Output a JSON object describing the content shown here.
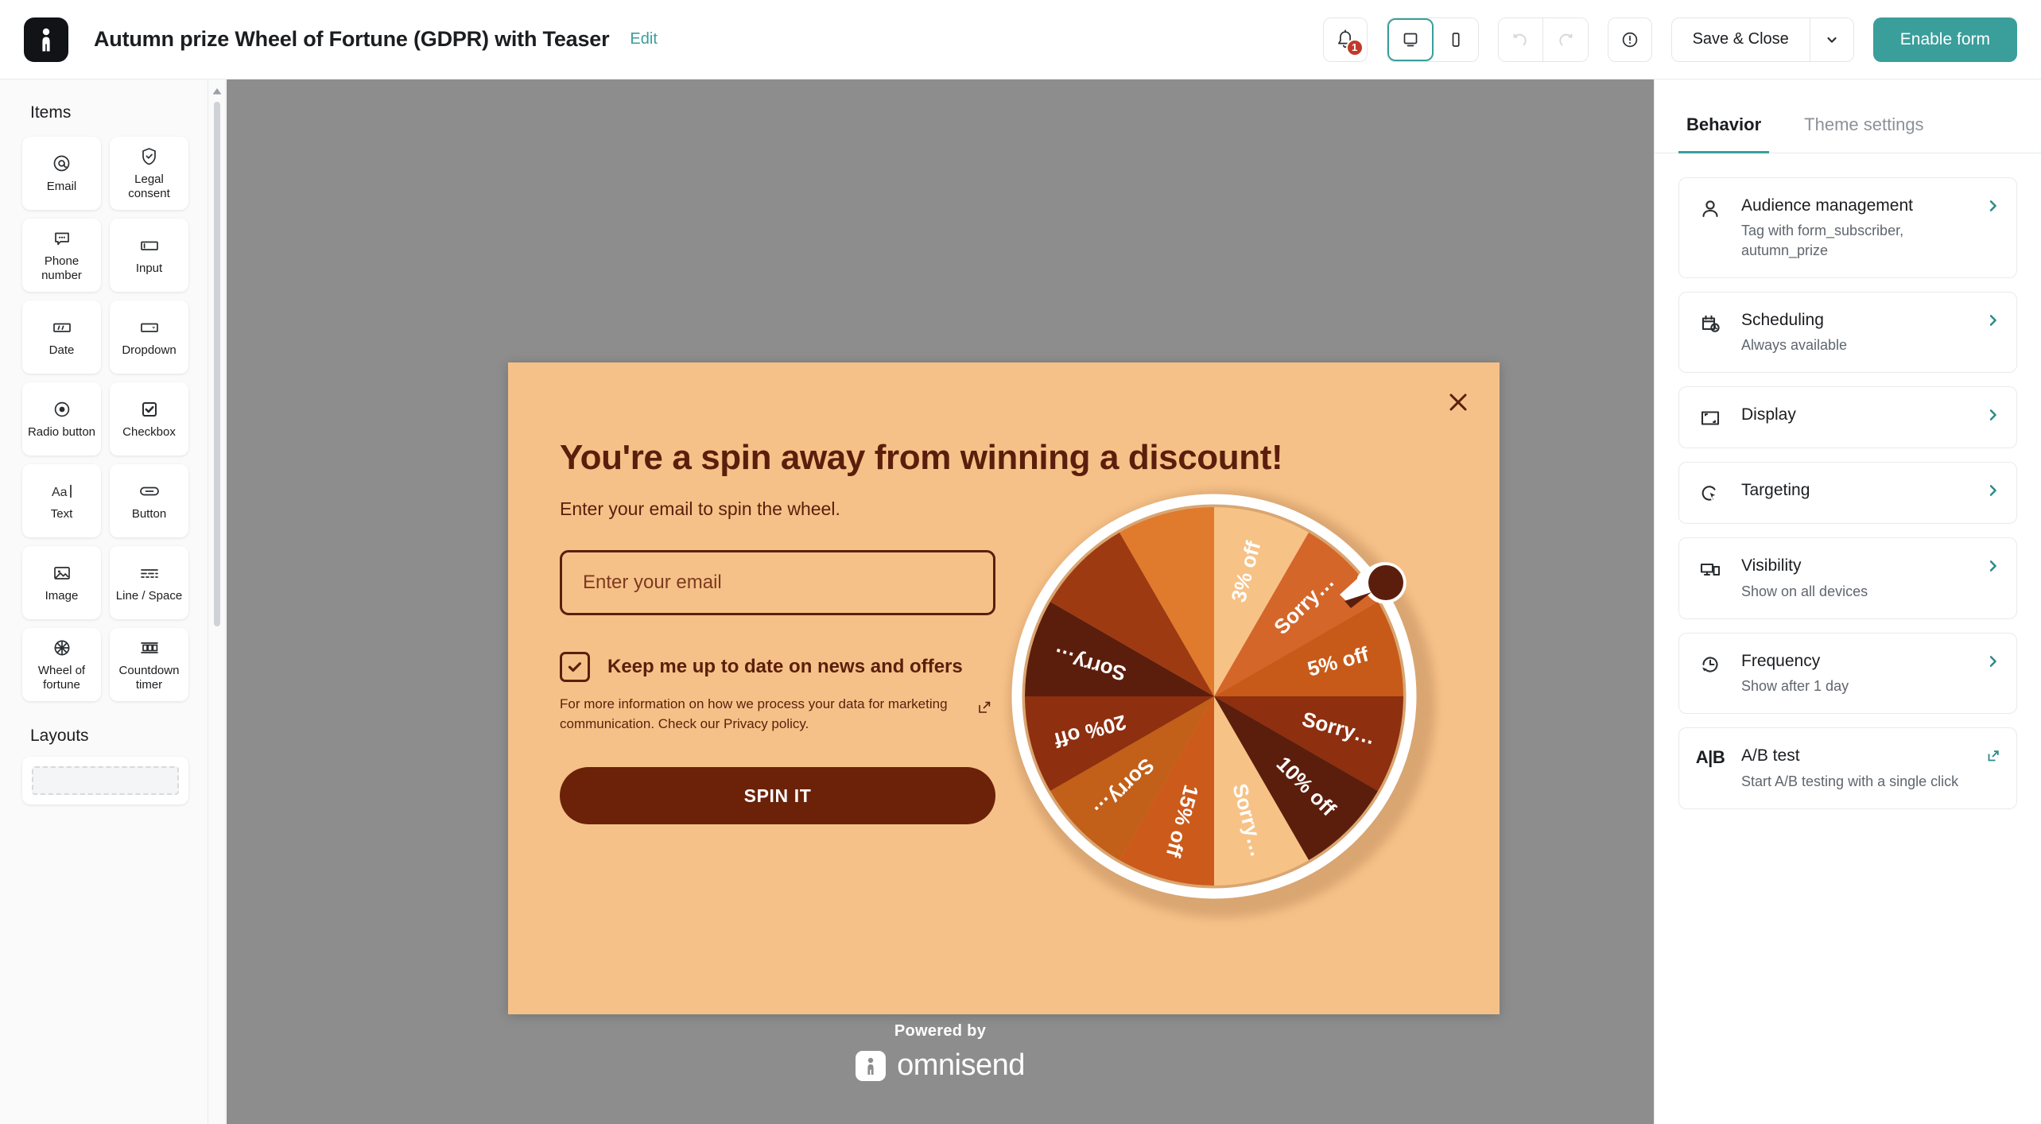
{
  "topbar": {
    "logo_icon": "omnisend-logo-icon",
    "title": "Autumn prize Wheel of Fortune (GDPR) with Teaser",
    "edit_label": "Edit",
    "notifications": {
      "icon": "bell-icon",
      "count": "1"
    },
    "device_desktop_icon": "desktop-icon",
    "device_mobile_icon": "mobile-icon",
    "undo_icon": "undo-icon",
    "redo_icon": "redo-icon",
    "alert_icon": "exclamation-circle-icon",
    "save_label": "Save & Close",
    "save_caret_icon": "chevron-down-icon",
    "enable_label": "Enable form",
    "accent_color": "#3a9e9b"
  },
  "sidebar": {
    "items_heading": "Items",
    "items": [
      {
        "label": "Email",
        "icon": "at-sign-icon"
      },
      {
        "label": "Legal consent",
        "icon": "shield-check-icon"
      },
      {
        "label": "Phone number",
        "icon": "speech-bubble-icon"
      },
      {
        "label": "Input",
        "icon": "text-input-icon"
      },
      {
        "label": "Date",
        "icon": "date-field-icon"
      },
      {
        "label": "Dropdown",
        "icon": "dropdown-icon"
      },
      {
        "label": "Radio button",
        "icon": "radio-button-icon"
      },
      {
        "label": "Checkbox",
        "icon": "checkbox-icon"
      },
      {
        "label": "Text",
        "icon": "text-aa-icon"
      },
      {
        "label": "Button",
        "icon": "button-pill-icon"
      },
      {
        "label": "Image",
        "icon": "image-icon"
      },
      {
        "label": "Line / Space",
        "icon": "line-space-icon"
      },
      {
        "label": "Wheel of fortune",
        "icon": "wheel-of-fortune-icon"
      },
      {
        "label": "Countdown timer",
        "icon": "countdown-timer-icon"
      }
    ],
    "layouts_heading": "Layouts",
    "scroll_up_icon": "caret-up-icon"
  },
  "popup": {
    "close_icon": "close-icon",
    "background_color": "#f6c188",
    "text_color": "#5c1e0c",
    "heading": "You're a spin away from winning a discount!",
    "subheading": "Enter your email to spin the wheel.",
    "email_placeholder": "Enter your email",
    "email_value": "",
    "consent_label": "Keep me up to date on news and offers",
    "consent_checked": true,
    "consent_note": "For more information on how we process your data for marketing communication. Check our Privacy policy.",
    "consent_external_icon": "external-link-icon",
    "spin_button_label": "SPIN IT",
    "spin_button_color": "#6b2209"
  },
  "wheel": {
    "segments": [
      {
        "label": "3% off",
        "color": "#f7c286"
      },
      {
        "label": "Sorry…",
        "color": "#d4662a"
      },
      {
        "label": "5% off",
        "color": "#c75a18"
      },
      {
        "label": "Sorry…",
        "color": "#8e2f10"
      },
      {
        "label": "10% off",
        "color": "#5c1e0c"
      },
      {
        "label": "Sorry…",
        "color": "#f7c286"
      },
      {
        "label": "15% off",
        "color": "#cc5a1a"
      },
      {
        "label": "Sorry…",
        "color": "#c25f18"
      },
      {
        "label": "20% off",
        "color": "#8e2f10"
      },
      {
        "label": "Sorry…",
        "color": "#5c1e0c"
      },
      {
        "label": "",
        "color": "#9e3a12"
      },
      {
        "label": "",
        "color": "#e07a2d"
      }
    ],
    "rim_color": "#ffffff",
    "pointer_color": "#5c1e0c",
    "pointer_icon": "wheel-pointer-icon"
  },
  "footer": {
    "powered_by": "Powered by",
    "brand": "omnisend",
    "brand_icon": "omnisend-mark-icon"
  },
  "rightpanel": {
    "tabs": [
      {
        "label": "Behavior",
        "active": true
      },
      {
        "label": "Theme settings",
        "active": false
      }
    ],
    "cards": [
      {
        "title": "Audience management",
        "desc": "Tag with form_subscriber, autumn_prize",
        "icon": "person-icon",
        "arrow": "chevron-right-icon"
      },
      {
        "title": "Scheduling",
        "desc": "Always available",
        "icon": "calendar-clock-icon",
        "arrow": "chevron-right-icon"
      },
      {
        "title": "Display",
        "desc": "",
        "icon": "display-frame-icon",
        "arrow": "chevron-right-icon"
      },
      {
        "title": "Targeting",
        "desc": "",
        "icon": "targeting-cursor-icon",
        "arrow": "chevron-right-icon"
      },
      {
        "title": "Visibility",
        "desc": "Show on all devices",
        "icon": "devices-icon",
        "arrow": "chevron-right-icon"
      },
      {
        "title": "Frequency",
        "desc": "Show after 1 day",
        "icon": "clock-history-icon",
        "arrow": "chevron-right-icon"
      },
      {
        "title": "A/B test",
        "desc": "Start A/B testing with a single click",
        "icon": "ab-test-icon",
        "arrow": "external-link-icon"
      }
    ]
  }
}
